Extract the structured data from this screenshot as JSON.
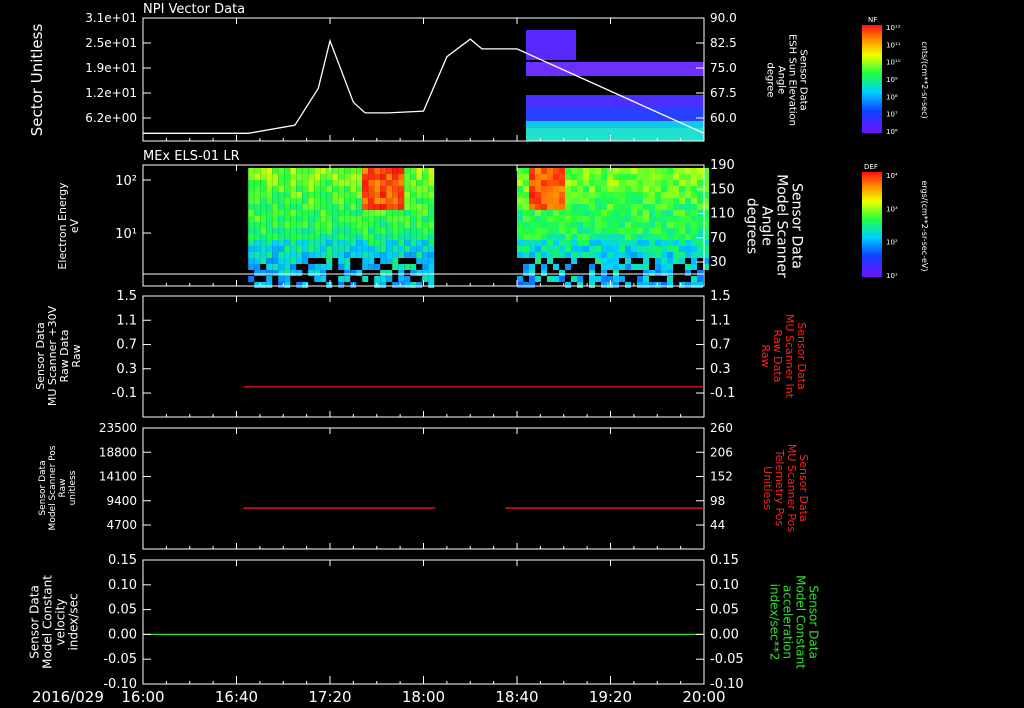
{
  "date_label": "2016/029",
  "time_ticks": [
    "16:00",
    "16:40",
    "17:20",
    "18:00",
    "18:40",
    "19:20",
    "20:00"
  ],
  "colors": {
    "bg": "#000000",
    "axis": "#ffffff",
    "red": "#ff2020",
    "green": "#30e030"
  },
  "chart_data": [
    {
      "type": "line",
      "title": "NPI Vector Data",
      "ylabel": "Sector\nUnitless",
      "y_ticks": [
        "3.1e+01",
        "2.5e+01",
        "1.9e+01",
        "1.2e+01",
        "6.2e+00"
      ],
      "y2_label": "Sensor Data\nESH Sun Elevation\nAngle\ndegree",
      "y2_ticks": [
        "90.0",
        "82.5",
        "75.0",
        "67.5",
        "60.0"
      ],
      "y2lim": [
        55,
        90
      ],
      "x": [
        "16:00",
        "16:45",
        "17:05",
        "17:15",
        "17:20",
        "17:30",
        "17:35",
        "17:45",
        "18:00",
        "18:10",
        "18:20",
        "18:25",
        "18:40",
        "20:00"
      ],
      "values": [
        57.2,
        57.2,
        59.5,
        70,
        83.5,
        66,
        63,
        63,
        63.5,
        79,
        84,
        81.2,
        81.2,
        57.2
      ],
      "spectrogram_colorbar": {
        "label": "NF",
        "units": "cnts/(cm**2-sr-sec)",
        "ticks": [
          "10¹²",
          "10¹¹",
          "10¹⁰",
          "10⁹",
          "10⁸",
          "10⁷",
          "10⁶"
        ]
      }
    },
    {
      "type": "heatmap",
      "title": "MEx ELS-01 LR",
      "ylabel": "Electron Energy\neV",
      "y_ticks": [
        "10²",
        "10¹"
      ],
      "y2_label": "Sensor Data\nModel Scanner\nAngle\ndegrees",
      "y2_ticks": [
        "190",
        "150",
        "110",
        "70",
        "30"
      ],
      "colorbar": {
        "label": "DEF",
        "units": "ergs/(cm**2-sr-sec-eV)",
        "ticks": [
          "10⁴",
          "10³",
          "10²",
          "10¹"
        ]
      },
      "line_value": 0
    },
    {
      "type": "line",
      "ylabel": "Sensor Data\nMU Scanner +30V\nRaw Data\nRaw",
      "y_ticks": [
        "1.5",
        "1.1",
        "0.7",
        "0.3",
        "-0.1"
      ],
      "y2_label": "Sensor Data\nMU Scanner Int\nRaw Data\nRaw",
      "y2_ticks": [
        "1.5",
        "1.1",
        "0.7",
        "0.3",
        "-0.1"
      ],
      "ylim": [
        -0.5,
        1.5
      ],
      "series": [
        {
          "x": [
            "16:43",
            "20:00"
          ],
          "values": [
            0.0,
            0.0
          ]
        }
      ]
    },
    {
      "type": "line",
      "ylabel": "Sensor Data\nModel Scanner Pos\nRaw\nunitless",
      "y_ticks": [
        "23500",
        "18800",
        "14100",
        "9400",
        "4700"
      ],
      "y2_label": "Sensor Data\nMU Scanner Pos\nTelemetry Pos\nUnitless",
      "y2_ticks": [
        "260",
        "206",
        "152",
        "98",
        "44"
      ],
      "ylim": [
        0,
        23500
      ],
      "series": [
        {
          "x": [
            "16:43",
            "18:05"
          ],
          "values": [
            7950,
            7950
          ]
        },
        {
          "x": [
            "18:35",
            "20:00"
          ],
          "values": [
            7950,
            7950
          ]
        }
      ]
    },
    {
      "type": "line",
      "ylabel": "Sensor Data\nModel Constant\nvelocity\nindex/sec",
      "y_ticks": [
        "0.15",
        "0.10",
        "0.05",
        "0.00",
        "-0.05",
        "-0.10"
      ],
      "y2_label": "Sensor Data\nModel Constant\nacceleration\nindex/sec**2",
      "y2_ticks": [
        "0.15",
        "0.10",
        "0.05",
        "0.00",
        "-0.05",
        "-0.10"
      ],
      "ylim": [
        -0.1,
        0.15
      ],
      "series": [
        {
          "x": [
            "16:00",
            "20:00"
          ],
          "values": [
            0.0,
            0.0
          ]
        }
      ]
    }
  ]
}
